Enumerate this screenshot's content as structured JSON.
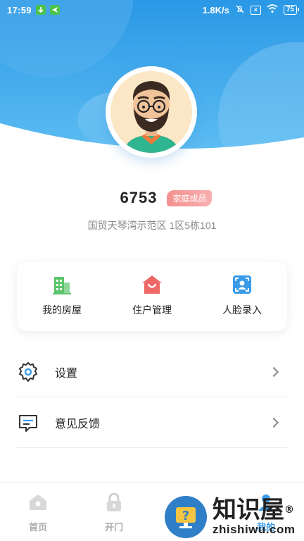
{
  "status_bar": {
    "time": "17:59",
    "net_speed": "1.8K/s",
    "battery": "75"
  },
  "profile": {
    "name": "6753",
    "role_badge": "家庭成员",
    "address": "国贸天琴湾示范区 1区5栋101"
  },
  "quick_actions": [
    {
      "label": "我的房屋",
      "icon": "building-icon",
      "color": "#5cc46a"
    },
    {
      "label": "住户管理",
      "icon": "house-smile-icon",
      "color": "#f06767"
    },
    {
      "label": "人脸录入",
      "icon": "face-scan-icon",
      "color": "#3a9be8"
    }
  ],
  "menu": [
    {
      "label": "设置",
      "icon": "gear-icon"
    },
    {
      "label": "意见反馈",
      "icon": "feedback-icon"
    }
  ],
  "tabbar": [
    {
      "label": "首页",
      "icon": "home-icon",
      "active": false
    },
    {
      "label": "开门",
      "icon": "lock-icon",
      "active": false
    },
    {
      "label": "",
      "icon": "blank",
      "active": false
    },
    {
      "label": "我的",
      "icon": "user-icon",
      "active": true
    }
  ],
  "watermark": {
    "big": "知识屋",
    "small": "zhishiwu.com",
    "reg": "®"
  },
  "colors": {
    "accent": "#3a9be8",
    "hero_top": "#2f9be6",
    "badge": "#f58f8f"
  }
}
